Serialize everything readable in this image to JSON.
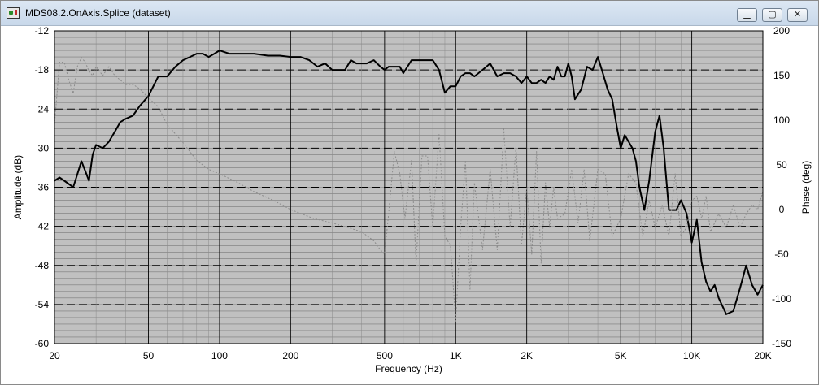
{
  "window": {
    "title": "MDS08.2.OnAxis.Splice (dataset)",
    "buttons": {
      "minimize": "▁",
      "maximize": "▢",
      "close": "✕"
    },
    "icon": "app-icon"
  },
  "chart_data": {
    "type": "line",
    "xlabel": "Frequency (Hz)",
    "ylabel": "Amplitude (dB)",
    "y2label": "Phase (deg)",
    "x_scale": "log",
    "xlim": [
      20,
      20000
    ],
    "ylim": [
      -60,
      -12
    ],
    "y2lim": [
      -150,
      200
    ],
    "x_ticks": [
      {
        "value": 20,
        "label": "20"
      },
      {
        "value": 50,
        "label": "50"
      },
      {
        "value": 100,
        "label": "100"
      },
      {
        "value": 200,
        "label": "200"
      },
      {
        "value": 500,
        "label": "500"
      },
      {
        "value": 1000,
        "label": "1K"
      },
      {
        "value": 2000,
        "label": "2K"
      },
      {
        "value": 5000,
        "label": "5K"
      },
      {
        "value": 10000,
        "label": "10K"
      },
      {
        "value": 20000,
        "label": "20K"
      }
    ],
    "y_ticks": [
      "-12",
      "-18",
      "-24",
      "-30",
      "-36",
      "-42",
      "-48",
      "-54",
      "-60"
    ],
    "y2_ticks": [
      "200",
      "150",
      "100",
      "50",
      "0",
      "-50",
      "-100",
      "-150"
    ],
    "grid": true,
    "plot_background": "#c0c0c0",
    "series": [
      {
        "style": "solid-black",
        "x": [
          20,
          21,
          22,
          23,
          24,
          25,
          26,
          27,
          28,
          29,
          30,
          32,
          34,
          36,
          38,
          40,
          43,
          46,
          50,
          55,
          60,
          65,
          70,
          75,
          80,
          85,
          90,
          95,
          100,
          110,
          120,
          140,
          160,
          180,
          200,
          220,
          240,
          260,
          280,
          300,
          320,
          340,
          360,
          380,
          400,
          420,
          450,
          480,
          500,
          520,
          550,
          580,
          600,
          650,
          700,
          750,
          800,
          850,
          900,
          950,
          1000,
          1050,
          1100,
          1150,
          1200,
          1300,
          1400,
          1500,
          1600,
          1700,
          1800,
          1900,
          2000,
          2100,
          2200,
          2300,
          2400,
          2500,
          2600,
          2700,
          2800,
          2900,
          3000,
          3100,
          3200,
          3400,
          3600,
          3800,
          4000,
          4200,
          4400,
          4600,
          4800,
          5000,
          5200,
          5400,
          5600,
          5800,
          6000,
          6300,
          6600,
          7000,
          7300,
          7600,
          8000,
          8300,
          8600,
          9000,
          9500,
          10000,
          10500,
          11000,
          11500,
          12000,
          12500,
          13000,
          14000,
          15000,
          16000,
          17000,
          18000,
          19000,
          20000
        ],
        "values": [
          -35,
          -34.5,
          -35,
          -35.5,
          -36,
          -34,
          -32,
          -33.5,
          -35,
          -31,
          -29.5,
          -30,
          -29,
          -27.5,
          -26,
          -25.5,
          -25,
          -23.5,
          -22,
          -19,
          -19,
          -17.5,
          -16.5,
          -16,
          -15.5,
          -15.5,
          -16,
          -15.5,
          -15,
          -15.5,
          -15.5,
          -15.5,
          -15.8,
          -15.8,
          -16,
          -16,
          -16.5,
          -17.5,
          -17,
          -18,
          -18,
          -18,
          -16.5,
          -17,
          -17,
          -17,
          -16.5,
          -17.5,
          -18,
          -17.5,
          -17.5,
          -17.5,
          -18.5,
          -16.5,
          -16.5,
          -16.5,
          -16.5,
          -18,
          -21.5,
          -20.5,
          -20.5,
          -19,
          -18.5,
          -18.5,
          -19,
          -18,
          -17,
          -19,
          -18.5,
          -18.5,
          -19,
          -20,
          -19,
          -20,
          -20,
          -19.5,
          -20,
          -19,
          -19.5,
          -17.5,
          -19,
          -19,
          -17,
          -19,
          -22.5,
          -21,
          -17.5,
          -18,
          -16,
          -18.5,
          -21,
          -22.5,
          -26.5,
          -30,
          -28,
          -29,
          -30,
          -32,
          -36,
          -39.5,
          -35,
          -27.5,
          -25,
          -30,
          -39.5,
          -39.5,
          -39.5,
          -38,
          -40,
          -44.5,
          -41,
          -47.5,
          -50.5,
          -52,
          -51,
          -53,
          -55.5,
          -55,
          -51.5,
          -48,
          -51,
          -52.5,
          -51
        ]
      },
      {
        "style": "dotted-gray",
        "axis": "right",
        "x": [
          20,
          21,
          22,
          23,
          24,
          25,
          26,
          27,
          28,
          29,
          30,
          32,
          34,
          36,
          38,
          40,
          43,
          46,
          50,
          55,
          60,
          70,
          80,
          90,
          100,
          120,
          140,
          170,
          200,
          250,
          300,
          350,
          400,
          450,
          480,
          500,
          520,
          550,
          580,
          610,
          650,
          680,
          720,
          760,
          800,
          850,
          900,
          950,
          1000,
          1050,
          1100,
          1150,
          1200,
          1300,
          1400,
          1500,
          1600,
          1700,
          1800,
          1900,
          2000,
          2100,
          2200,
          2300,
          2400,
          2500,
          2600,
          2700,
          2900,
          3100,
          3300,
          3500,
          3700,
          4000,
          4300,
          4600,
          5000,
          5400,
          5800,
          6200,
          6600,
          7000,
          7500,
          8000,
          8500,
          9000,
          9500,
          10000,
          10500,
          11000,
          11500,
          12000,
          13000,
          14000,
          15000,
          16000,
          17000,
          18000,
          19000,
          20000
        ],
        "values": [
          95,
          165,
          165,
          145,
          130,
          160,
          170,
          165,
          155,
          150,
          160,
          150,
          160,
          150,
          145,
          140,
          140,
          135,
          125,
          115,
          95,
          75,
          55,
          45,
          40,
          30,
          20,
          10,
          0,
          -10,
          -15,
          -20,
          -25,
          -35,
          -45,
          -50,
          -5,
          65,
          40,
          -10,
          55,
          -60,
          60,
          60,
          -20,
          85,
          -30,
          -40,
          -125,
          -20,
          55,
          -90,
          30,
          -45,
          45,
          -45,
          90,
          -20,
          70,
          -40,
          25,
          -50,
          65,
          -60,
          30,
          -20,
          25,
          -10,
          -5,
          45,
          -15,
          45,
          -35,
          45,
          40,
          -30,
          -10,
          40,
          30,
          -30,
          10,
          -20,
          5,
          -30,
          40,
          -30,
          -20,
          10,
          15,
          -10,
          15,
          -25,
          -5,
          -20,
          5,
          -20,
          -5,
          5,
          0,
          20
        ]
      }
    ]
  }
}
